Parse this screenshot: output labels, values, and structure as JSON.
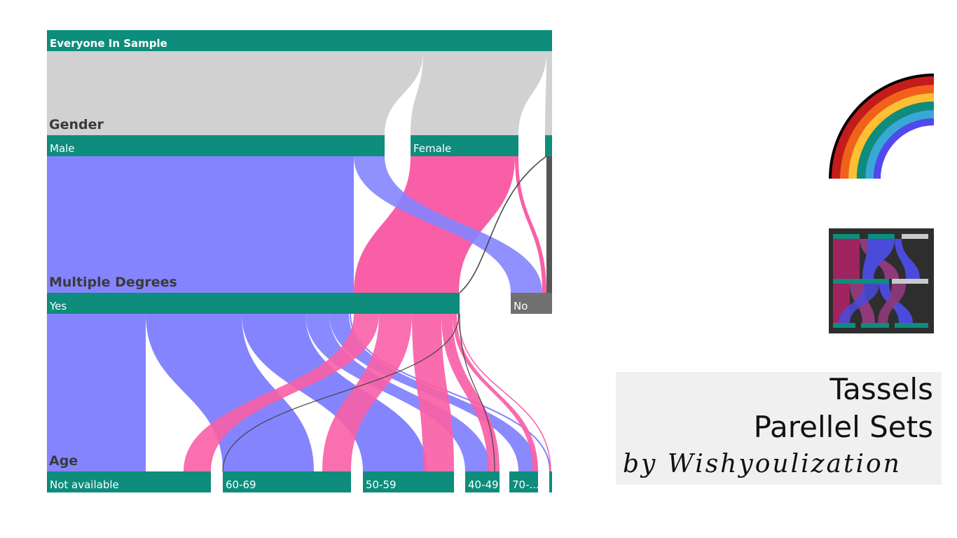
{
  "diagram": {
    "root_label": "Everyone In Sample",
    "dimensions": {
      "gender": "Gender",
      "degrees": "Multiple Degrees",
      "age": "Age"
    },
    "gender_categories": [
      "Male",
      "Female"
    ],
    "degree_categories": [
      "Yes",
      "No"
    ],
    "age_categories": [
      "Not available",
      "60-69",
      "50-59",
      "40-49",
      "70-..."
    ],
    "colors": {
      "bar": "#0e8c7c",
      "root_band": "#d0d1d0",
      "male": "#8484ff",
      "female": "#f85fa6",
      "other": "#555555",
      "no_bar": "#707070"
    }
  },
  "branding": {
    "title_line1": "Tassels",
    "title_line2": "Parellel Sets",
    "byline": "by Wishyoulization",
    "logo_icon": "rainbow-icon",
    "thumbnail_icon": "parallel-sets-thumbnail-icon"
  }
}
